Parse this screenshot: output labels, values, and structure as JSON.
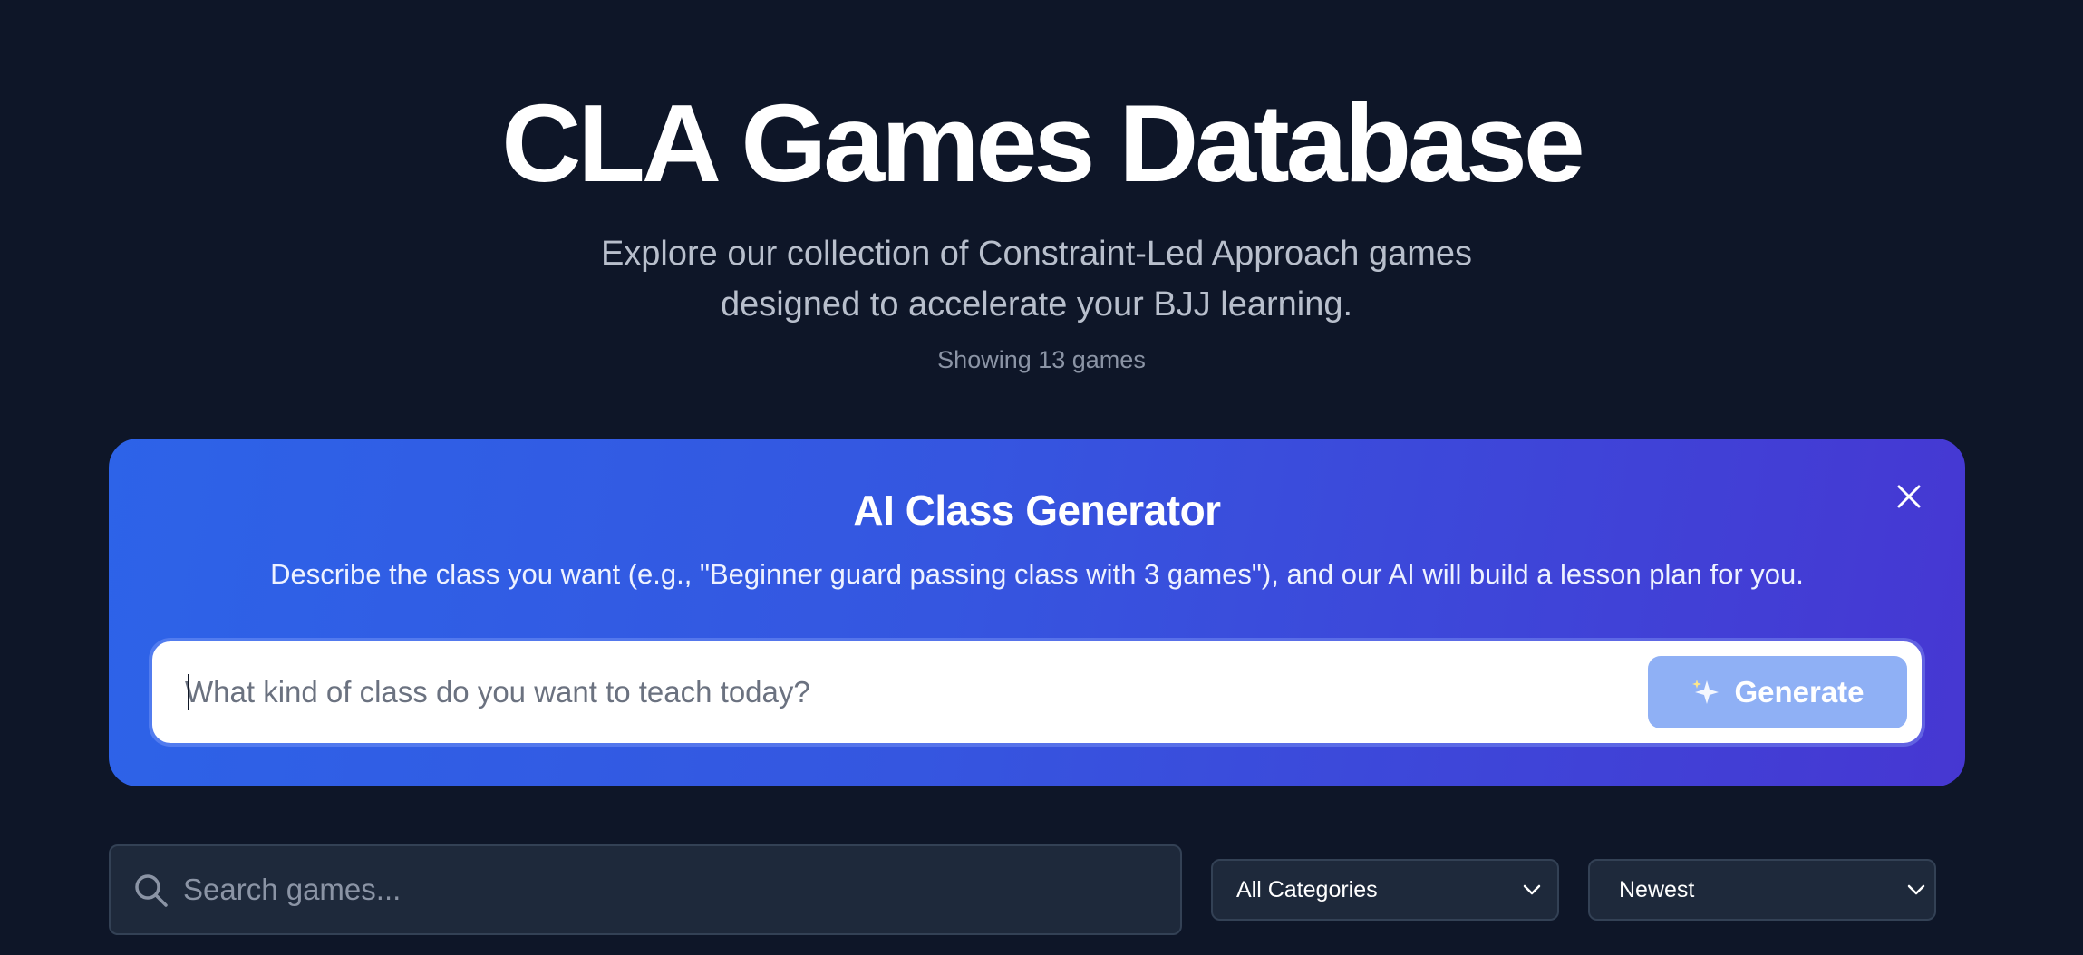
{
  "hero": {
    "title": "CLA Games Database",
    "subtitle": "Explore our collection of Constraint-Led Approach games designed to accelerate your BJJ learning.",
    "count_text": "Showing 13 games"
  },
  "ai_generator": {
    "title": "AI Class Generator",
    "description": "Describe the class you want (e.g., \"Beginner guard passing class with 3 games\"), and our AI will build a lesson plan for you.",
    "input_placeholder": "What kind of class do you want to teach today?",
    "input_value": "",
    "generate_label": "Generate",
    "generate_icon": "sparkles-icon",
    "close_icon": "close-icon"
  },
  "filters": {
    "search_placeholder": "Search games...",
    "search_icon": "search-icon",
    "category_selected": "All Categories",
    "sort_selected": "Newest"
  },
  "colors": {
    "background": "#0e1628",
    "panel_gradient_start": "#2d63e8",
    "panel_gradient_end": "#4637d2",
    "generate_button": "#8fb0f5",
    "control_background": "#1e293b"
  }
}
